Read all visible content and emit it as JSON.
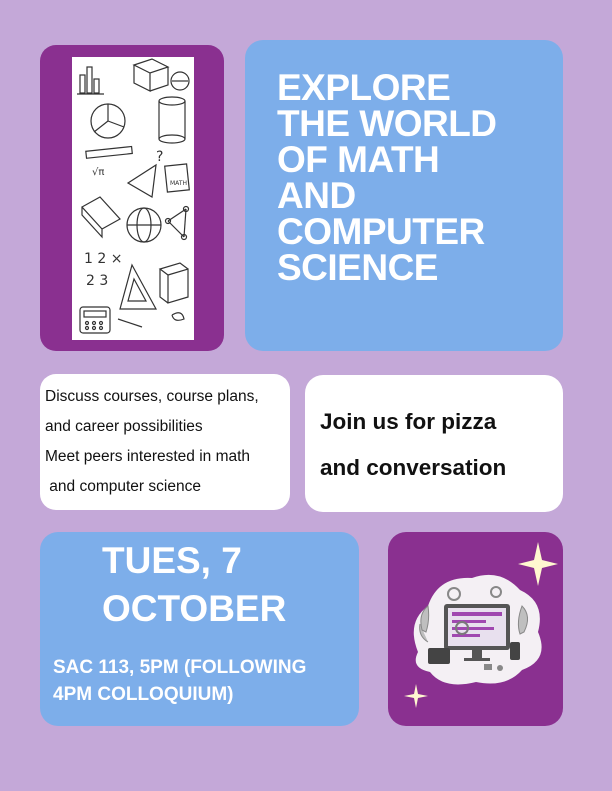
{
  "title": "EXPLORE\nTHE WORLD\nOF MATH\nAND\nCOMPUTER\nSCIENCE",
  "info": {
    "lines": [
      "Discuss courses, course plans,",
      "and career possibilities",
      "Meet peers interested in math",
      " and computer science"
    ]
  },
  "pizza": "Join us for pizza\nand conversation",
  "event": {
    "date": "TUES, 7\nOCTOBER",
    "location": "SAC 113, 5PM (FOLLOWING\n4PM COLLOQUIUM)"
  },
  "images": {
    "left": "math-doodle-icons",
    "right": "computer-illustration-icon"
  },
  "colors": {
    "background": "#c4a8d8",
    "purple": "#8a3090",
    "blue": "#7daeea",
    "white": "#ffffff"
  }
}
